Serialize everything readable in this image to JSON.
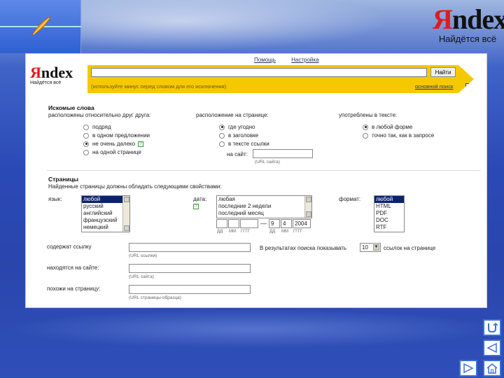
{
  "slide": {
    "logo_word_first": "Я",
    "logo_word_rest": "ndex",
    "logo_tagline": "Найдётся всё"
  },
  "links": {
    "help": "Помощь",
    "settings": "Настройка"
  },
  "inner_logo": {
    "first": "Я",
    "rest": "ndex",
    "tagline": "Найдётся всё"
  },
  "search": {
    "query": "",
    "button": "Найти",
    "hint": "(используйте минус перед словом для его исключения)",
    "basic_search_link": "основной поиск"
  },
  "words": {
    "title": "Искомые слова",
    "subtitle": "расположены относительно друг друга:",
    "proximity_options": [
      {
        "label": "подряд",
        "selected": false
      },
      {
        "label": "в одном предложении",
        "selected": false
      },
      {
        "label": "не очень далеко",
        "selected": true
      },
      {
        "label": "на одной странице",
        "selected": false
      }
    ],
    "location_label": "расположение на странице:",
    "location_options": [
      {
        "label": "где угодно",
        "selected": true
      },
      {
        "label": "в заголовке",
        "selected": false
      },
      {
        "label": "в тексте ссылки",
        "selected": false
      }
    ],
    "site_label": "на сайт:",
    "site_hint": "(URL сайта)",
    "usage_label": "употреблены в тексте:",
    "usage_options": [
      {
        "label": "в любой форме",
        "selected": true
      },
      {
        "label": "точно так, как в запросе",
        "selected": false
      }
    ]
  },
  "pages": {
    "title": "Страницы",
    "subtitle": "Найденные страницы должны обладать следующими свойствами:",
    "language_label": "язык:",
    "languages": [
      "любой",
      "русский",
      "английский",
      "французский",
      "немецкий"
    ],
    "date_label": "дата:",
    "date_options": [
      "любая",
      "последние 2 недели",
      "последний месяц"
    ],
    "date_from": {
      "dd": "",
      "mm": "",
      "yyyy": ""
    },
    "date_to": {
      "dd": "9",
      "mm": "4",
      "yyyy": "2004"
    },
    "date_field_labels": {
      "dd": "ДД",
      "mm": "ММ",
      "yyyy": "ГГГГ"
    },
    "date_dash": "—",
    "format_label": "формат:",
    "formats": [
      "любой",
      "HTML",
      "PDF",
      "DOC",
      "RTF"
    ],
    "contains_link_label": "содержат ссылку",
    "contains_link_hint": "(URL ссылки)",
    "on_site_label": "находятся на сайте:",
    "on_site_hint": "(URL сайта)",
    "similar_label": "похожи на страницу:",
    "similar_hint": "(URL страницы-образца)",
    "results_prefix": "В результатах поиска показывать",
    "results_count": "10",
    "results_suffix": "ссылок на странице"
  },
  "nav": {
    "icons": [
      "return-icon",
      "back-arrow-icon",
      "forward-arrow-icon",
      "home-icon"
    ]
  },
  "colors": {
    "yellow_band": "#f5c800",
    "logo_red": "#e01b1b",
    "selection": "#0a246a",
    "nav_border": "#3d6fd6"
  }
}
